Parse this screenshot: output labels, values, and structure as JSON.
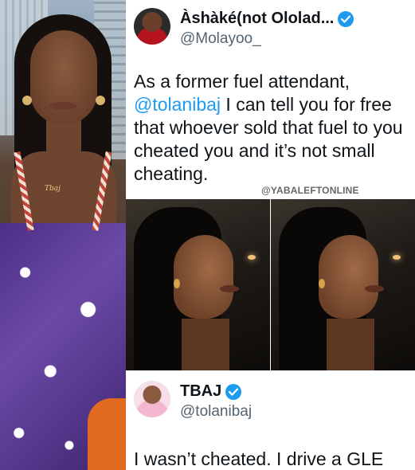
{
  "tweet1": {
    "display_name": "Àshàké(not Ololad...",
    "handle": "@Molayoo_",
    "text_before": "As a former fuel attendant, ",
    "mention": "@tolanibaj",
    "text_after": " I can tell you for free that whoever sold that fuel to you cheated you and it’s not small cheating.",
    "verified": true
  },
  "watermark": "@YABALEFTONLINE",
  "left_photo": {
    "necklace_text": "Tbaj"
  },
  "tweet2": {
    "display_name": "TBAJ",
    "handle": "@tolanibaj",
    "text": "I wasn’t cheated. I drive a GLE",
    "verified": true
  },
  "colors": {
    "verified": "#1d9bf0",
    "mention": "#1d9bf0",
    "handle": "#536471",
    "text": "#0f1419"
  },
  "icons": {
    "verified": "verified-badge-icon"
  }
}
